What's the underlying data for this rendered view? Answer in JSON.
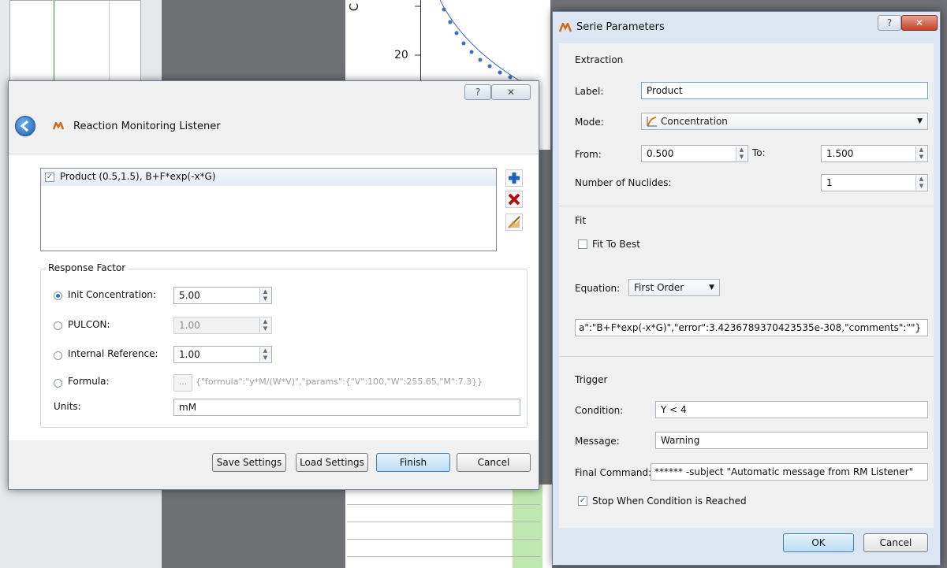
{
  "background": {
    "plot_ticks": [
      "20"
    ],
    "plot_axis_letter": "C"
  },
  "listener": {
    "title": "Reaction Monitoring Listener",
    "help_btn": "?",
    "close_btn": "✕",
    "series": [
      {
        "label": "Product (0.5,1.5), B+F*exp(-x*G)",
        "checked": true
      }
    ],
    "response_factor": {
      "title": "Response Factor",
      "init_concentration": {
        "label": "Init Concentration:",
        "value": "5.00"
      },
      "pulcon": {
        "label": "PULCON:",
        "value": "1.00"
      },
      "internal_reference": {
        "label": "Internal Reference:",
        "value": "1.00"
      },
      "formula": {
        "label": "Formula:",
        "button": "...",
        "value": "{\"formula\":\"y*M/(W*V)\",\"params\":{\"V\":100,\"W\":255.65,\"M\":7.3}}"
      },
      "units": {
        "label": "Units:",
        "value": "mM"
      }
    },
    "buttons": {
      "save": "Save Settings",
      "load": "Load Settings",
      "finish": "Finish",
      "cancel": "Cancel"
    }
  },
  "serie": {
    "title": "Serie Parameters",
    "help_btn": "?",
    "close_btn": "✕",
    "extraction": {
      "title": "Extraction",
      "label_label": "Label:",
      "label_value": "Product",
      "mode_label": "Mode:",
      "mode_value": "Concentration",
      "from_label": "From:",
      "from_value": "0.500",
      "to_label": "To:",
      "to_value": "1.500",
      "nuclides_label": "Number of Nuclides:",
      "nuclides_value": "1"
    },
    "fit": {
      "title": "Fit",
      "fit_to_best": "Fit To Best",
      "equation_label": "Equation:",
      "equation_value": "First Order",
      "json_value": "a\":\"B+F*exp(-x*G)\",\"error\":3.4236789370423535e-308,\"comments\":\"\"}"
    },
    "trigger": {
      "title": "Trigger",
      "condition_label": "Condition:",
      "condition_value": "Y < 4",
      "message_label": "Message:",
      "message_value": "Warning",
      "final_command_label": "Final Command:",
      "final_command_value": "****** -subject \"Automatic message from RM Listener\"",
      "stop_when_reached": "Stop When Condition is Reached"
    },
    "buttons": {
      "ok": "OK",
      "cancel": "Cancel"
    }
  }
}
